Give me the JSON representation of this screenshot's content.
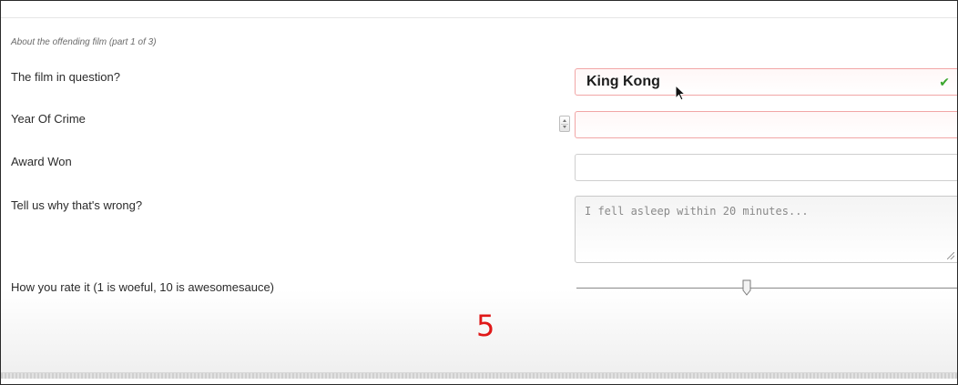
{
  "form": {
    "legend": "About the offending film (part 1 of 3)",
    "film": {
      "label": "The film in question?",
      "value": "King Kong",
      "valid": true
    },
    "year": {
      "label": "Year Of Crime",
      "value": ""
    },
    "award": {
      "label": "Award Won",
      "value": ""
    },
    "reason": {
      "label": "Tell us why that's wrong?",
      "placeholder": "I fell asleep within 20 minutes..."
    },
    "rating": {
      "label": "How you rate it (1 is woeful, 10 is awesomesauce)",
      "min": 1,
      "max": 10,
      "value": "5"
    }
  },
  "colors": {
    "error_border": "#f1a6a6",
    "valid_check": "#3aa62e",
    "rating_text": "#e01818"
  },
  "icons": {
    "valid": "checkmark-icon",
    "cursor": "mouse-pointer-icon",
    "spinner": "number-spinner-icon",
    "resize": "resize-grip-icon"
  }
}
